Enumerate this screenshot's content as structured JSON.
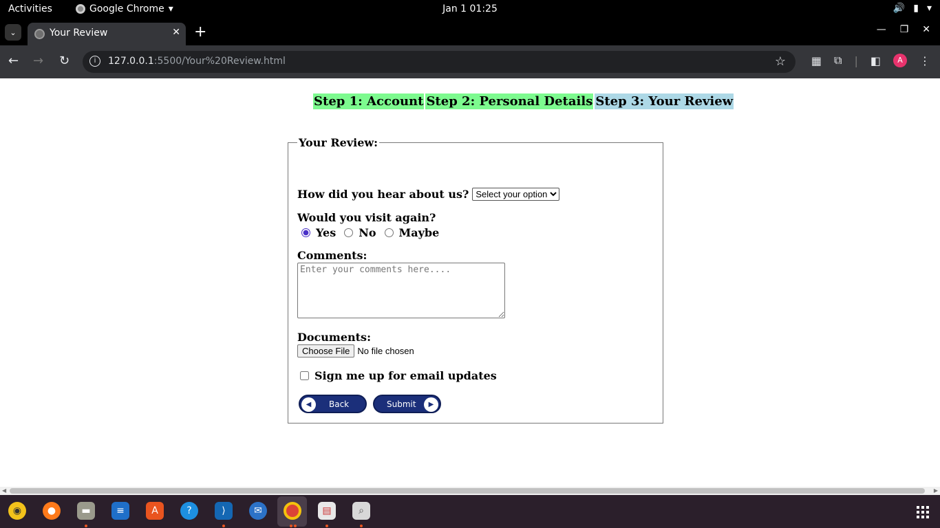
{
  "system": {
    "activities": "Activities",
    "app_name": "Google Chrome",
    "clock": "Jan 1  01:25"
  },
  "browser": {
    "tab_title": "Your Review",
    "url_host": "127.0.0.1",
    "url_rest": ":5500/Your%20Review.html",
    "avatar_letter": "A"
  },
  "page": {
    "steps": {
      "step1": "Step 1: Account",
      "step2": "Step 2: Personal Details",
      "step3": "Step 3: Your Review"
    },
    "legend": "Your Review:",
    "hear_label": "How did you hear about us?",
    "hear_select": "Select your option",
    "visit_label": "Would you visit again?",
    "radio_yes": "Yes",
    "radio_no": "No",
    "radio_maybe": "Maybe",
    "visit_selected": "Yes",
    "comments_label": "Comments:",
    "comments_placeholder": "Enter your comments here....",
    "docs_label": "Documents:",
    "choose_file": "Choose File",
    "no_file": "No file chosen",
    "email_label": "Sign me up for email updates",
    "back_button": "Back",
    "submit_button": "Submit"
  },
  "colors": {
    "step_done": "#7dfa8f",
    "step_current": "#add8e6",
    "button_navy": "#1b2f7a"
  },
  "dock_icons": [
    "rhythmbox-icon",
    "firefox-icon",
    "files-icon",
    "writer-icon",
    "app-center-icon",
    "help-icon",
    "vscode-icon",
    "thunderbird-icon",
    "chrome-icon",
    "text-editor-icon",
    "image-viewer-icon",
    "app-grid-icon"
  ]
}
